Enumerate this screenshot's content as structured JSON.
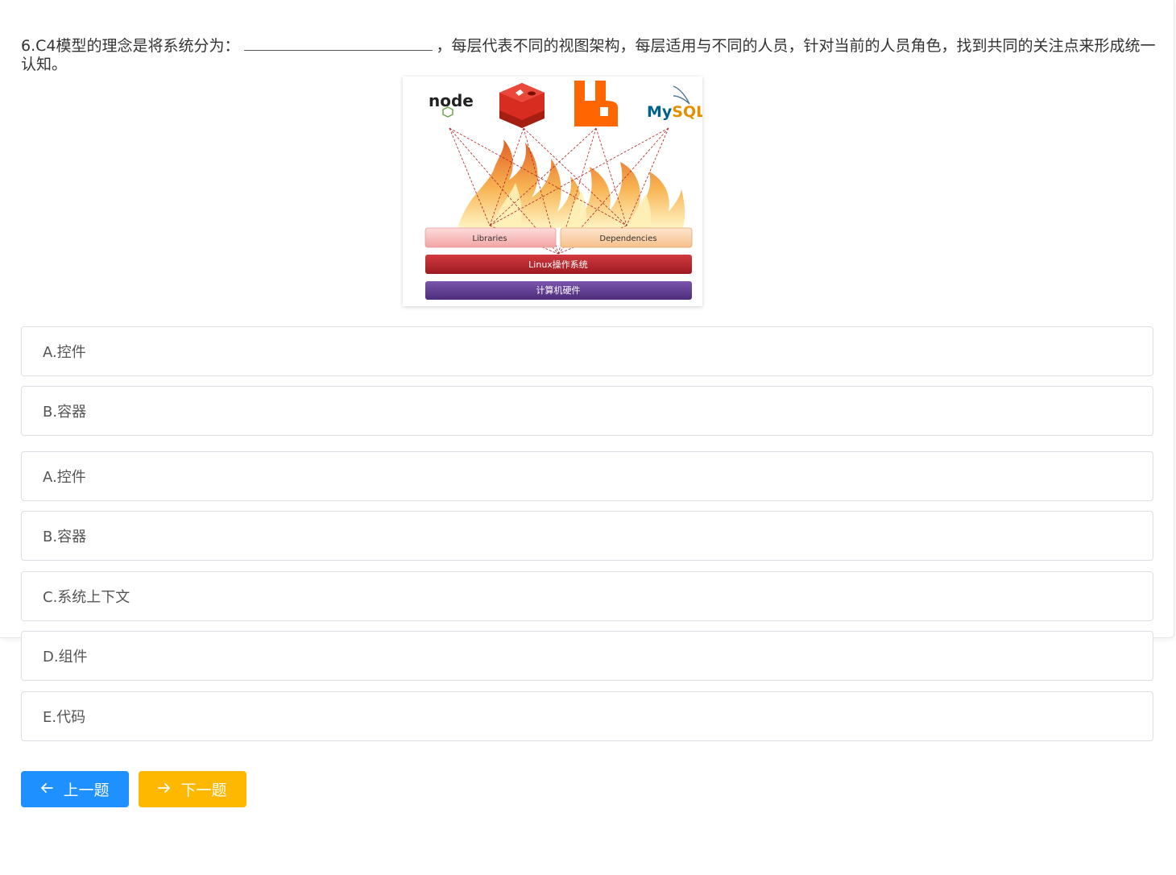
{
  "question": {
    "before_blank": "6.C4模型的理念是将系统分为：",
    "after_blank": "，每层代表不同的视图架构，每层适用与不同的人员，针对当前的人员角色，找到共同的关注点来形成统一认知。"
  },
  "figure": {
    "logos": [
      "node",
      "MySQL"
    ],
    "layers": {
      "libraries": "Libraries",
      "dependencies": "Dependencies",
      "os": "Linux操作系统",
      "hardware": "计算机硬件"
    },
    "colors": {
      "libraries": "#f7b6b6",
      "dependencies": "#fbd3ae",
      "os": "#b4212a",
      "hardware": "#5b3a8c",
      "redis": "#d82c20",
      "rabbitmq": "#ff6600"
    }
  },
  "options": [
    {
      "label": "A.控件"
    },
    {
      "label": "B.容器"
    },
    {
      "label": "A.控件"
    },
    {
      "label": "B.容器"
    },
    {
      "label": "C.系统上下文"
    },
    {
      "label": "D.组件"
    },
    {
      "label": "E.代码"
    }
  ],
  "buttons": {
    "prev": {
      "label": "上一题",
      "icon": "arrow-left-icon",
      "color": "#1e90ff"
    },
    "next": {
      "label": "下一题",
      "icon": "arrow-right-icon",
      "color": "#ffb800"
    }
  }
}
